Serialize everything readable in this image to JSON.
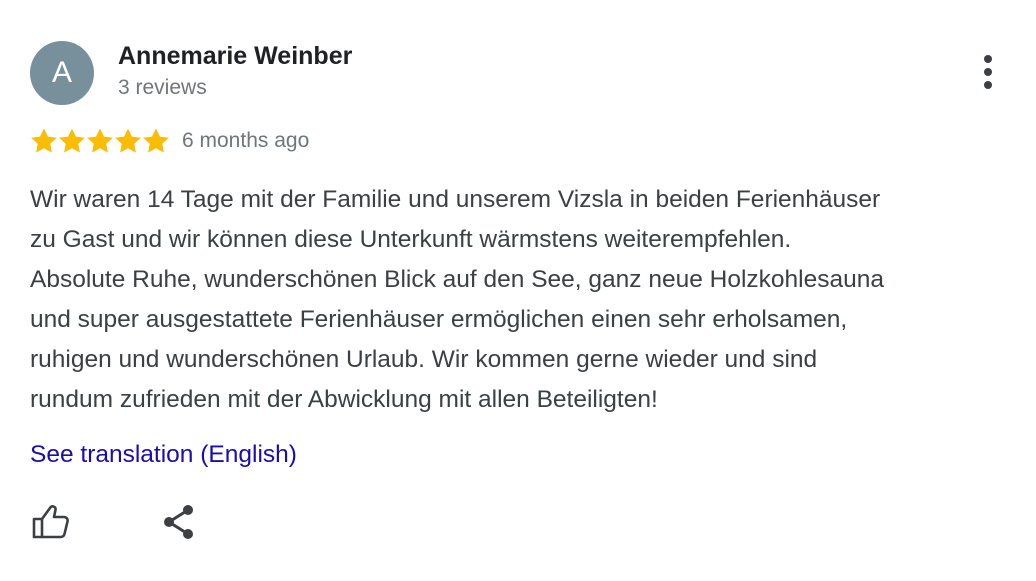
{
  "review": {
    "avatar_letter": "A",
    "author_name": "Annemarie Weinber",
    "review_count": "3 reviews",
    "rating": 5,
    "rating_max": 5,
    "time_ago": "6 months ago",
    "text": "Wir waren 14 Tage mit der Familie und unserem Vizsla in beiden Ferienhäuser\nzu Gast und wir können diese Unterkunft wärmstens weiterempfehlen.\nAbsolute Ruhe, wunderschönen Blick auf den See, ganz neue Holzkohlesauna\nund super ausgestattete Ferienhäuser ermöglichen einen sehr erholsamen,\nruhigen und wunderschönen Urlaub. Wir kommen gerne wieder und sind\nrundum zufrieden mit der Abwicklung mit allen Beteiligten!",
    "translation_link": "See translation (English)"
  },
  "icons": {
    "more": "more-vert-icon",
    "like": "thumb-up-icon",
    "share": "share-icon",
    "star": "star-icon"
  },
  "colors": {
    "avatar_bg": "#78909c",
    "star": "#fbbc04",
    "link": "#1a0dab",
    "name": "#202124",
    "meta": "#70757a",
    "body": "#3c4043",
    "icon": "#3c4043"
  }
}
